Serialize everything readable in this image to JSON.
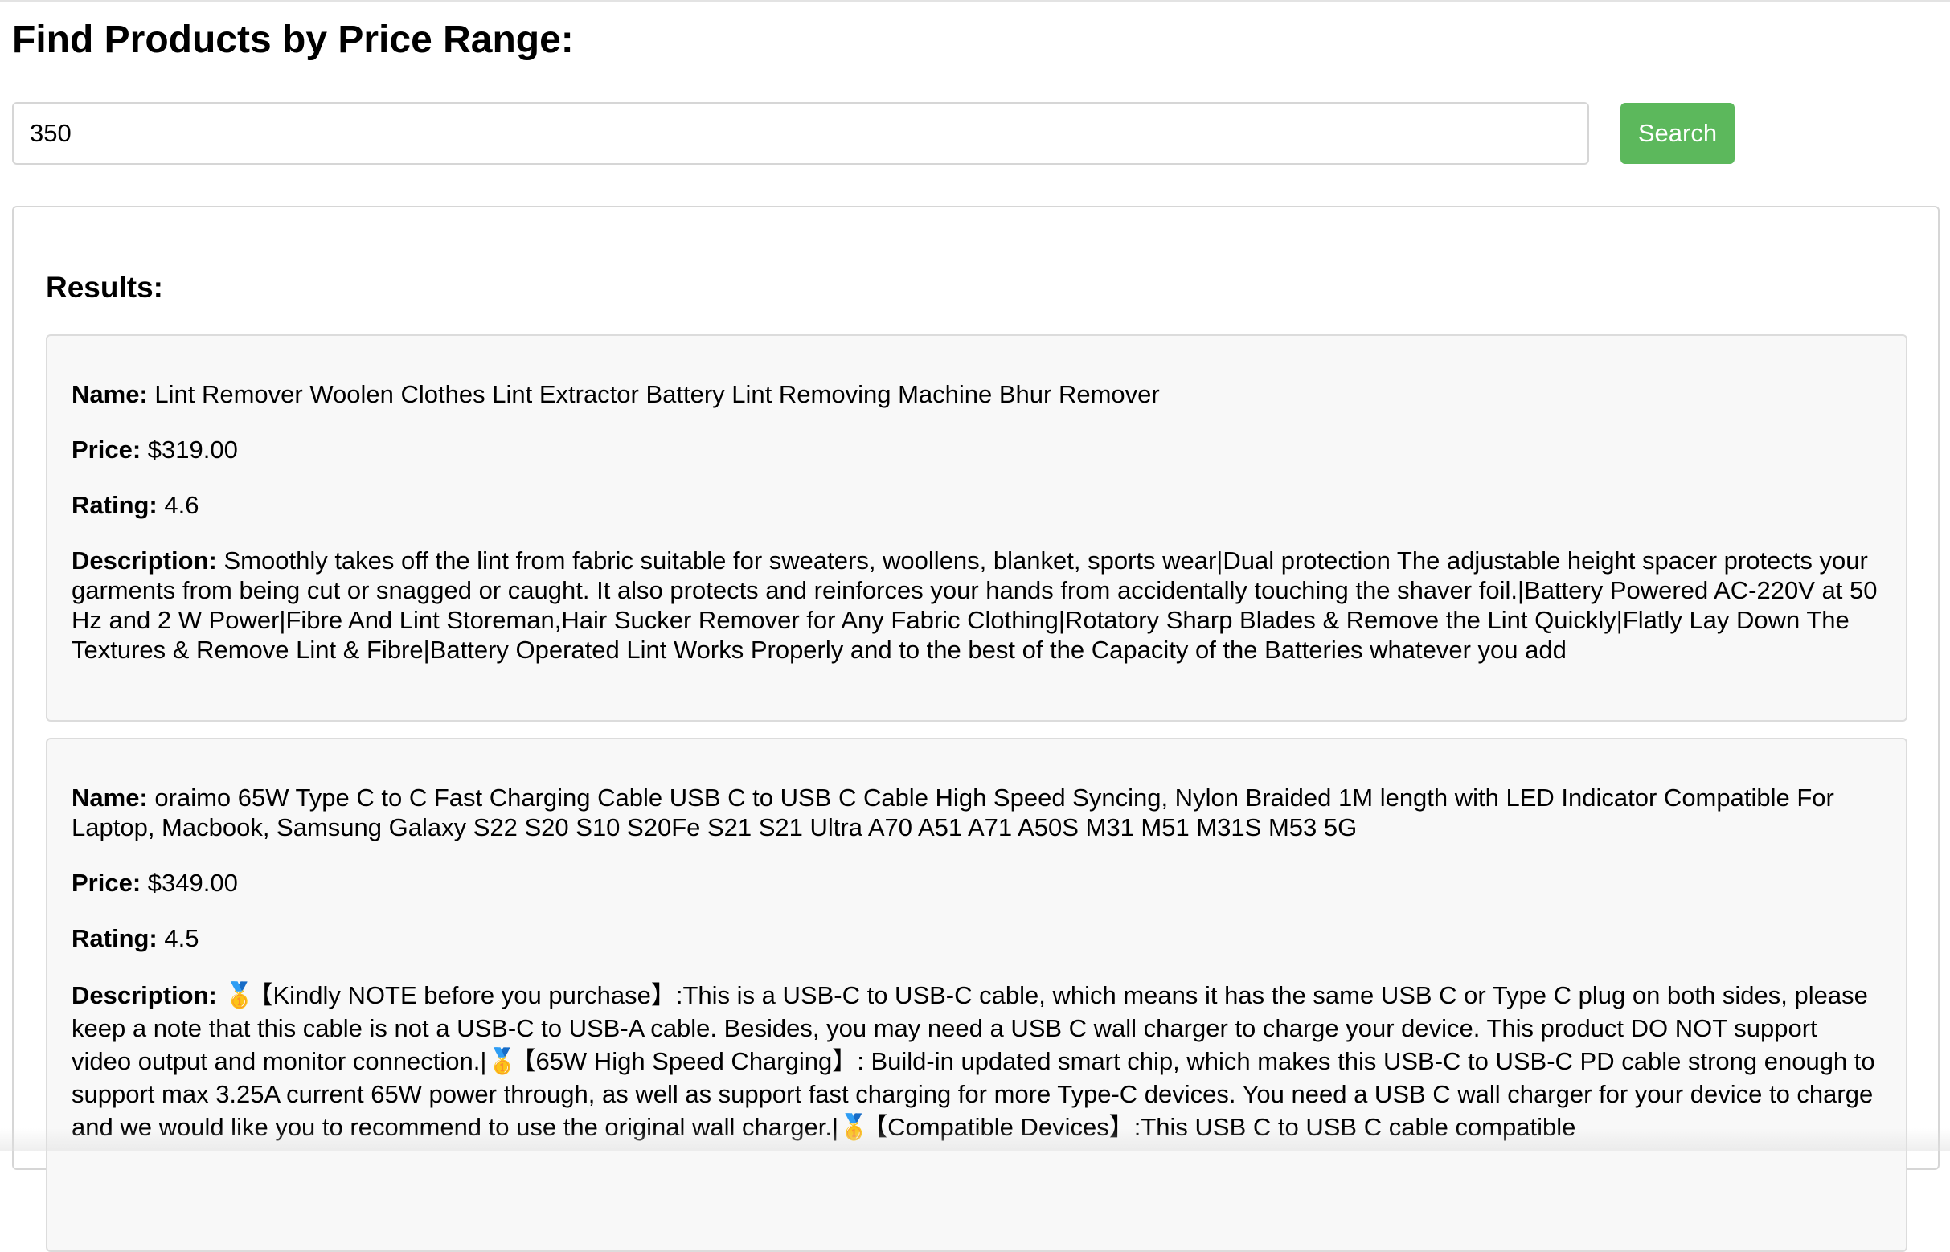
{
  "page": {
    "title": "Find Products by Price Range:"
  },
  "search": {
    "value": "350",
    "button_label": "Search"
  },
  "results": {
    "heading": "Results:",
    "labels": {
      "name": "Name:",
      "price": "Price:",
      "rating": "Rating:",
      "description": "Description:"
    },
    "items": [
      {
        "name": "Lint Remover Woolen Clothes Lint Extractor Battery Lint Removing Machine Bhur Remover",
        "price": "$319.00",
        "rating": "4.6",
        "description": "Smoothly takes off the lint from fabric suitable for sweaters, woollens, blanket, sports wear|Dual protection The adjustable height spacer protects your garments from being cut or snagged or caught. It also protects and reinforces your hands from accidentally touching the shaver foil.|Battery Powered AC-220V at 50 Hz and 2 W Power|Fibre And Lint Storeman,Hair Sucker Remover for Any Fabric Clothing|Rotatory Sharp Blades & Remove the Lint Quickly|Flatly Lay Down The Textures & Remove Lint & Fibre|Battery Operated Lint Works Properly and to the best of the Capacity of the Batteries whatever you add"
      },
      {
        "name": "oraimo 65W Type C to C Fast Charging Cable USB C to USB C Cable High Speed Syncing, Nylon Braided 1M length with LED Indicator Compatible For Laptop, Macbook, Samsung Galaxy S22 S20 S10 S20Fe S21 S21 Ultra A70 A51 A71 A50S M31 M51 M31S M53 5G",
        "price": "$349.00",
        "rating": "4.5",
        "description_parts": [
          "【Kindly NOTE before you purchase】:This is a USB-C to USB-C cable, which means it has the same USB C or Type C plug on both sides, please keep a note that this cable is not a USB-C to USB-A cable. Besides, you may need a USB C wall charger to charge your device. This product DO NOT support video output and monitor connection.|",
          "【65W High Speed Charging】: Build-in updated smart chip, which makes this USB-C to USB-C PD cable strong enough to support max 3.25A current 65W power through, as well as support fast charging for more Type-C devices. You need a USB C wall charger for your device to charge and we would like you to recommend to use the original wall charger.|",
          "【Compatible Devices】:This USB C to USB C cable compatible"
        ],
        "description_icon": "medal-icon"
      }
    ]
  }
}
